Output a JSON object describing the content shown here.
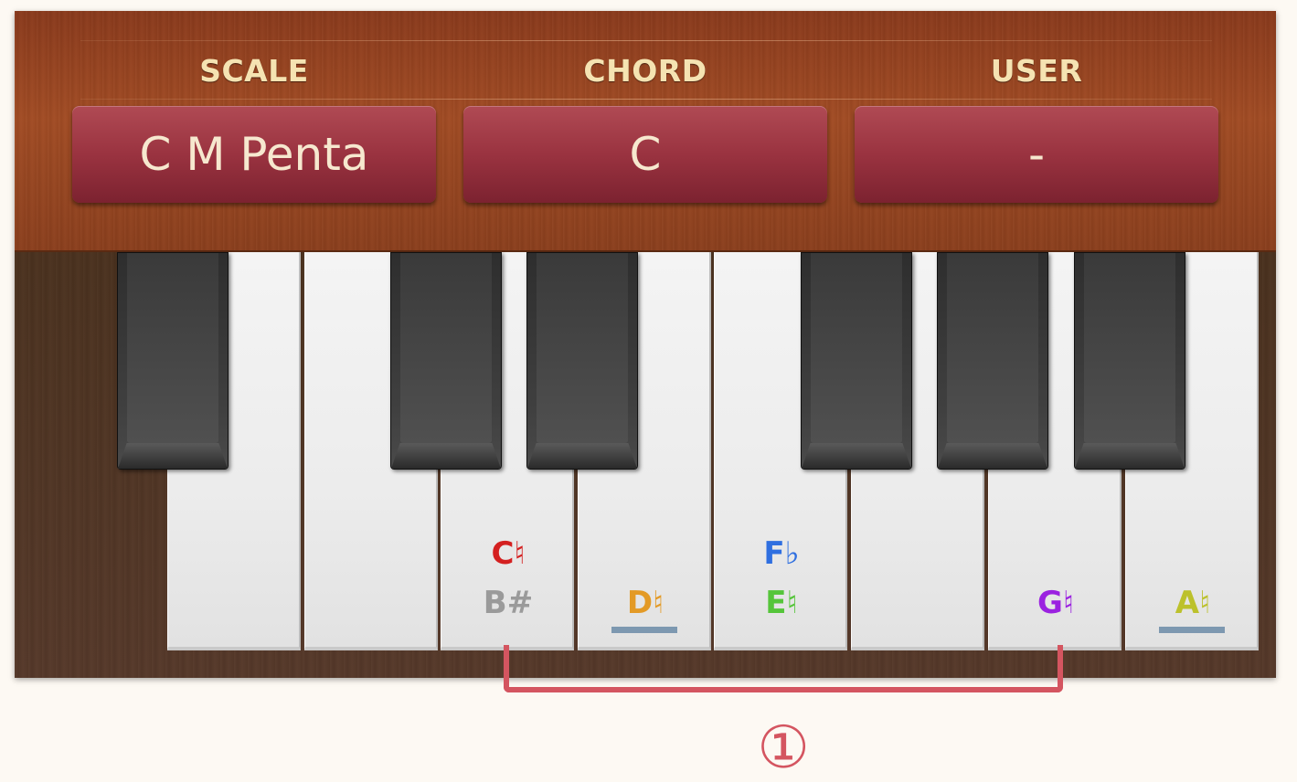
{
  "header": {
    "labels": {
      "scale": "SCALE",
      "chord": "CHORD",
      "user": "USER"
    },
    "buttons": {
      "scale": "C M Penta",
      "chord": "C",
      "user": "-"
    }
  },
  "keyboard": {
    "white_keys": [
      {
        "top": "",
        "bottom": "",
        "underlined": false
      },
      {
        "top": "C♮",
        "top_color": "#d42020",
        "bottom": "B#",
        "bottom_color": "#9a9a9a",
        "underlined": false
      },
      {
        "top": "",
        "bottom": "D♮",
        "bottom_color": "#e39a26",
        "underlined": true
      },
      {
        "top": "F♭",
        "top_color": "#2f6fe0",
        "bottom": "E♮",
        "bottom_color": "#55c53a",
        "underlined": false
      },
      {
        "top": "",
        "bottom": "",
        "underlined": false
      },
      {
        "top": "",
        "bottom": "G♮",
        "bottom_color": "#9b22e0",
        "underlined": false
      },
      {
        "top": "",
        "bottom": "A♮",
        "bottom_color": "#bcc12c",
        "underlined": true
      }
    ],
    "black_key_count": 6,
    "underline_color": "#7d98b0"
  },
  "annotation": {
    "marker": "①",
    "color": "#d45560"
  }
}
